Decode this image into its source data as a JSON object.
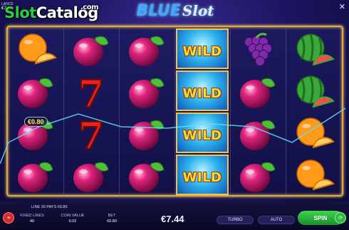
{
  "header": {
    "corner_label": "LANCE",
    "corner_balance": "€7.44",
    "watermark": {
      "slot": "Slot",
      "catalog": "Catalog",
      "dotcom": ".com"
    },
    "logo": {
      "blue": "BLUE",
      "slot": "Slot"
    },
    "close_icon": "close-icon"
  },
  "reels": [
    [
      "orange",
      "plum",
      "plum",
      "plum"
    ],
    [
      "plum",
      "seven",
      "seven",
      "plum"
    ],
    [
      "plum",
      "plum",
      "plum",
      "plum"
    ],
    [
      "wild",
      "wild",
      "wild",
      "wild"
    ],
    [
      "grapes",
      "plum",
      "plum",
      "plum"
    ],
    [
      "watermelon",
      "watermelon",
      "orange",
      "orange"
    ]
  ],
  "wild_label": "WILD",
  "win_badge": "€0.80",
  "colors": {
    "frame": "#e0a93a",
    "plum": "#e0237e",
    "leaf": "#4fbf3a",
    "wild": "#2fb2ee",
    "spin": "#2bbf3c"
  },
  "bottom": {
    "line_info": "LINE 30 PAYS €0.80",
    "fixed_lines_label": "FIXED LINES",
    "fixed_lines_value": "40",
    "coin_value_label": "COIN VALUE",
    "coin_value_value": "0.02",
    "bet_label": "BET",
    "bet_value": "€0.80",
    "balance": "€7.44",
    "turbo": "TURBO",
    "auto": "AUTO",
    "spin": "SPIN"
  }
}
